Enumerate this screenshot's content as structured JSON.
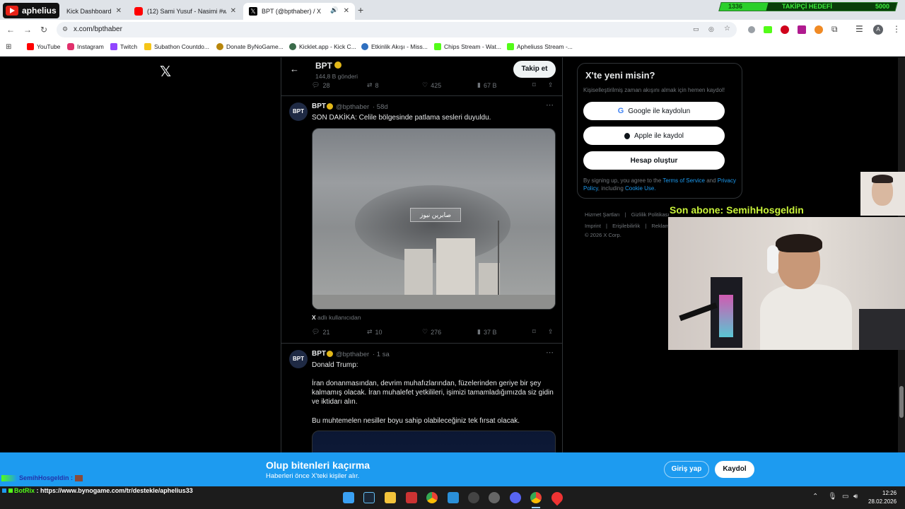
{
  "browser": {
    "tabs": [
      {
        "label": "Kick Dashboard",
        "icon": "kick-icon"
      },
      {
        "label": "(12) Sami Yusuf - Nasimi #work",
        "icon": "youtube-icon"
      },
      {
        "label": "BPT (@bpthaber) / X",
        "icon": "x-logo-icon"
      }
    ],
    "url": "x.com/bpthaber",
    "bookmarks": [
      {
        "label": "YouTube",
        "color": "#ff0000"
      },
      {
        "label": "Instagram",
        "color": "#e1306c"
      },
      {
        "label": "Twitch",
        "color": "#9146ff"
      },
      {
        "label": "Subathon Countdo...",
        "color": "#f5c518"
      },
      {
        "label": "Donate ByNoGame...",
        "color": "#b8860b"
      },
      {
        "label": "Kicklet.app - Kick C...",
        "color": "#3a6b4a"
      },
      {
        "label": "Etkinlik Akışı - Miss...",
        "color": "#2f6fbf"
      },
      {
        "label": "Chips Stream - Wat...",
        "color": "#53fc18"
      },
      {
        "label": "Apheliuss Stream -...",
        "color": "#53fc18"
      }
    ]
  },
  "stream_overlay": {
    "channel_logo_text": "aphelius",
    "follower_goal_current": "1336",
    "follower_goal_label": "TAKİPÇİ HEDEFİ",
    "follower_goal_target": "5000",
    "last_sub": "Son abone: SemihHosgeldin",
    "chat_line": "SemihHosgeldin :",
    "botrix_name": "BotRix",
    "botrix_message": "https://www.bynogame.com/tr/destekle/aphelius33"
  },
  "header": {
    "name": "BPT",
    "post_count": "144,8 B gönderi",
    "follow_button": "Takip et"
  },
  "tweet0_actions": {
    "replies": "28",
    "reposts": "8",
    "likes": "425",
    "views": "67 B"
  },
  "tweet1": {
    "name": "BPT",
    "handle": "@bpthaber",
    "time": "· 58d",
    "text": "SON DAKİKA: Celile bölgesinde patlama sesleri duyuldu.",
    "media_watermark": "صابرين نيوز",
    "source_prefix": "X",
    "source_text": "adlı kullanıcıdan",
    "replies": "21",
    "reposts": "10",
    "likes": "276",
    "views": "37 B"
  },
  "tweet2": {
    "name": "BPT",
    "handle": "@bpthaber",
    "time": "· 1 sa",
    "line1": "Donald Trump:",
    "line2": "İran donanmasından, devrim muhafızlarından, füzelerinden geriye bir şey kalmamış olacak. İran muhalefet yetkilileri, işimizi tamamladığımızda siz gidin ve iktidarı alın.",
    "line3": "Bu muhtemelen nesiller boyu sahip olabileceğiniz tek fırsat olacak."
  },
  "signup": {
    "title": "X'te yeni misin?",
    "subtitle": "Kişiselleştirilmiş zaman akışını almak için hemen kaydol!",
    "google": "Google ile kaydolun",
    "apple": "Apple ile kaydol",
    "create": "Hesap oluştur",
    "legal_1": "By signing up, you agree to the",
    "tos": "Terms of Service",
    "and": "and",
    "privacy": "Privacy Policy",
    "including": ", including",
    "cookie": "Cookie Use."
  },
  "footer_links": {
    "l1": "Hizmet Şartları",
    "l2": "Gizlilik Politikası",
    "l3": "Imprint",
    "l4": "Erişilebilirlik",
    "l5": "Reklam",
    "copyright": "© 2026 X Corp."
  },
  "banner": {
    "title": "Olup bitenleri kaçırma",
    "subtitle": "Haberleri önce X'teki kişiler alır.",
    "login": "Giriş yap",
    "signup": "Kaydol"
  },
  "taskbar": {
    "time": "12:26",
    "date": "28.02.2026"
  }
}
